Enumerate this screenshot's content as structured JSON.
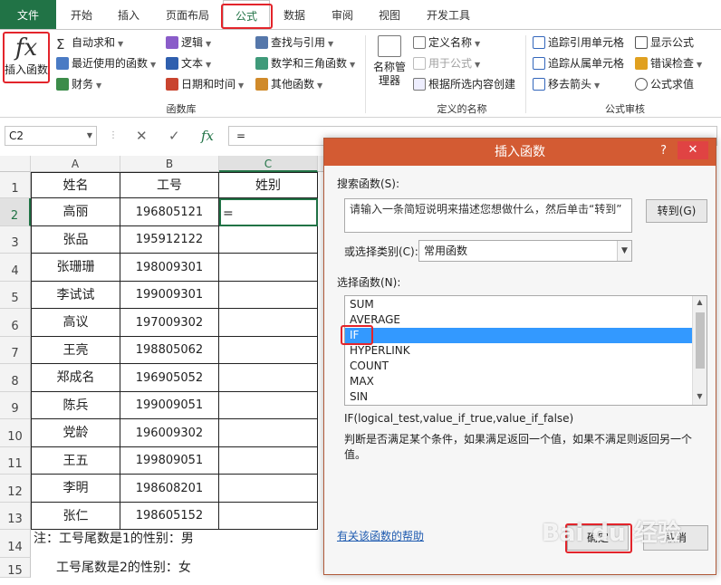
{
  "ribbon_tabs": [
    "文件",
    "开始",
    "插入",
    "页面布局",
    "公式",
    "数据",
    "审阅",
    "视图",
    "开发工具"
  ],
  "ribbon": {
    "insert_function": "插入函数",
    "function_library": {
      "autosum": "自动求和",
      "recent": "最近使用的函数",
      "financial": "财务",
      "logical": "逻辑",
      "text": "文本",
      "datetime": "日期和时间",
      "lookup": "查找与引用",
      "math": "数学和三角函数",
      "more": "其他函数",
      "group_label": "函数库"
    },
    "defined_names": {
      "name_manager": "名称管理器",
      "define_name": "定义名称",
      "use_in_formula": "用于公式",
      "create_from_selection": "根据所选内容创建",
      "group_label": "定义的名称"
    },
    "auditing": {
      "trace_precedents": "追踪引用单元格",
      "trace_dependents": "追踪从属单元格",
      "remove_arrows": "移去箭头",
      "show_formulas": "显示公式",
      "error_checking": "错误检查",
      "evaluate_formula": "公式求值",
      "group_label": "公式审核"
    }
  },
  "formula_bar": {
    "name_box": "C2",
    "cancel": "✕",
    "enter": "✓",
    "fx": "fx",
    "content": "="
  },
  "sheet": {
    "columns": [
      "A",
      "B",
      "C"
    ],
    "header_row": [
      "姓名",
      "工号",
      "姓别"
    ],
    "rows": [
      {
        "name": "高丽",
        "id": "196805121",
        "c": "="
      },
      {
        "name": "张品",
        "id": "195912122",
        "c": ""
      },
      {
        "name": "张珊珊",
        "id": "198009301",
        "c": ""
      },
      {
        "name": "李试试",
        "id": "199009301",
        "c": ""
      },
      {
        "name": "高议",
        "id": "197009302",
        "c": ""
      },
      {
        "name": "王亮",
        "id": "198805062",
        "c": ""
      },
      {
        "name": "郑成名",
        "id": "196905052",
        "c": ""
      },
      {
        "name": "陈兵",
        "id": "199009051",
        "c": ""
      },
      {
        "name": "党龄",
        "id": "196009302",
        "c": ""
      },
      {
        "name": "王五",
        "id": "199809051",
        "c": ""
      },
      {
        "name": "李明",
        "id": "198608201",
        "c": ""
      },
      {
        "name": "张仁",
        "id": "198605152",
        "c": ""
      }
    ],
    "row_numbers": [
      "1",
      "2",
      "3",
      "4",
      "5",
      "6",
      "7",
      "8",
      "9",
      "10",
      "11",
      "12",
      "13",
      "14",
      "15"
    ],
    "note1": "注：工号尾数是1的性别：男",
    "note2": "工号尾数是2的性别：女"
  },
  "dialog": {
    "title": "插入函数",
    "help": "?",
    "close": "✕",
    "search_label": "搜索函数(S):",
    "search_text": "请输入一条简短说明来描述您想做什么，然后单击“转到”",
    "go_button": "转到(G)",
    "category_label": "或选择类别(C):",
    "category_value": "常用函数",
    "select_label": "选择函数(N):",
    "functions": [
      "SUM",
      "AVERAGE",
      "IF",
      "HYPERLINK",
      "COUNT",
      "MAX",
      "SIN"
    ],
    "selected_function": "IF",
    "signature": "IF(logical_test,value_if_true,value_if_false)",
    "description": "判断是否满足某个条件，如果满足返回一个值，如果不满足则返回另一个值。",
    "help_link": "有关该函数的帮助",
    "ok_button": "确定",
    "cancel_button": "取消"
  },
  "watermark": "Bai du 经验",
  "colors": {
    "excel_green": "#217346",
    "dialog_title": "#d35b33",
    "highlight": "#e3242b",
    "selection": "#3399ff"
  }
}
